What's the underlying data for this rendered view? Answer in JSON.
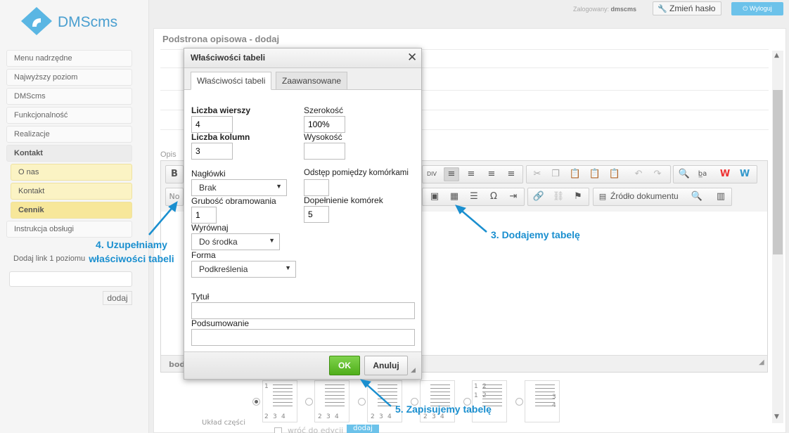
{
  "brand": {
    "name": "DMScms"
  },
  "sidebar": {
    "items": [
      {
        "label": "Menu nadrzędne"
      },
      {
        "label": "Najwyższy poziom"
      },
      {
        "label": "DMScms"
      },
      {
        "label": "Funkcjonalność"
      },
      {
        "label": "Realizacje"
      },
      {
        "label": "Kontakt"
      },
      {
        "label": "O nas"
      },
      {
        "label": "Kontakt"
      },
      {
        "label": "Cennik"
      },
      {
        "label": "Instrukcja obsługi"
      }
    ],
    "add_link_label": "Dodaj link 1 poziomu",
    "add_button": "dodaj"
  },
  "header": {
    "logged_label": "Zalogowany:",
    "user": "dmscms",
    "change_password": "Zmień hasło",
    "logout": "Wyloguj"
  },
  "page": {
    "title": "Podstrona opisowa - dodaj",
    "opis_label": "Opis",
    "status_path": "bod",
    "source_label": "Źródło dokumentu",
    "format_label": "No",
    "layout_label": "Układ części",
    "back_to_edit": "wróć do edycji",
    "add_button": "dodaj"
  },
  "dialog": {
    "title": "Właściwości tabeli",
    "tabs": [
      {
        "label": "Właściwości tabeli",
        "active": true
      },
      {
        "label": "Zaawansowane",
        "active": false
      }
    ],
    "fields": {
      "rows_label": "Liczba wierszy",
      "rows_value": "4",
      "cols_label": "Liczba kolumn",
      "cols_value": "3",
      "width_label": "Szerokość",
      "width_value": "100%",
      "height_label": "Wysokość",
      "height_value": "",
      "headers_label": "Nagłówki",
      "headers_value": "Brak",
      "cell_spacing_label": "Odstęp pomiędzy komórkami",
      "cell_spacing_value": "",
      "border_label": "Grubość obramowania",
      "border_value": "1",
      "cell_padding_label": "Dopełnienie komórek",
      "cell_padding_value": "5",
      "align_label": "Wyrównaj",
      "align_value": "Do środka",
      "form_label": "Forma",
      "form_value": "Podkreślenia",
      "caption_label": "Tytuł",
      "caption_value": "",
      "summary_label": "Podsumowanie",
      "summary_value": ""
    },
    "ok": "OK",
    "cancel": "Anuluj"
  },
  "layout_thumbs": [
    {
      "labels": [
        "1",
        "2",
        "3",
        "4"
      ]
    },
    {
      "labels": [
        "2",
        "3",
        "4"
      ]
    },
    {
      "labels": [
        "2",
        "3",
        "4"
      ]
    },
    {
      "labels": [
        "2",
        "3",
        "4"
      ]
    },
    {
      "labels": [
        "1",
        "2",
        "1",
        "2"
      ]
    },
    {
      "labels": [
        "3",
        "4"
      ]
    }
  ],
  "annotations": {
    "step3": "3. Dodajemy tabelę",
    "step4_line1": "4. Uzupełniamy",
    "step4_line2": "właściwości tabeli",
    "step5": "5. Zapisujemy tabelę"
  },
  "colors": {
    "accent": "#1a8fcf",
    "ok_green": "#4fae1a",
    "logout_blue": "#6cc2ea",
    "active_menu": "#f7e79a"
  }
}
